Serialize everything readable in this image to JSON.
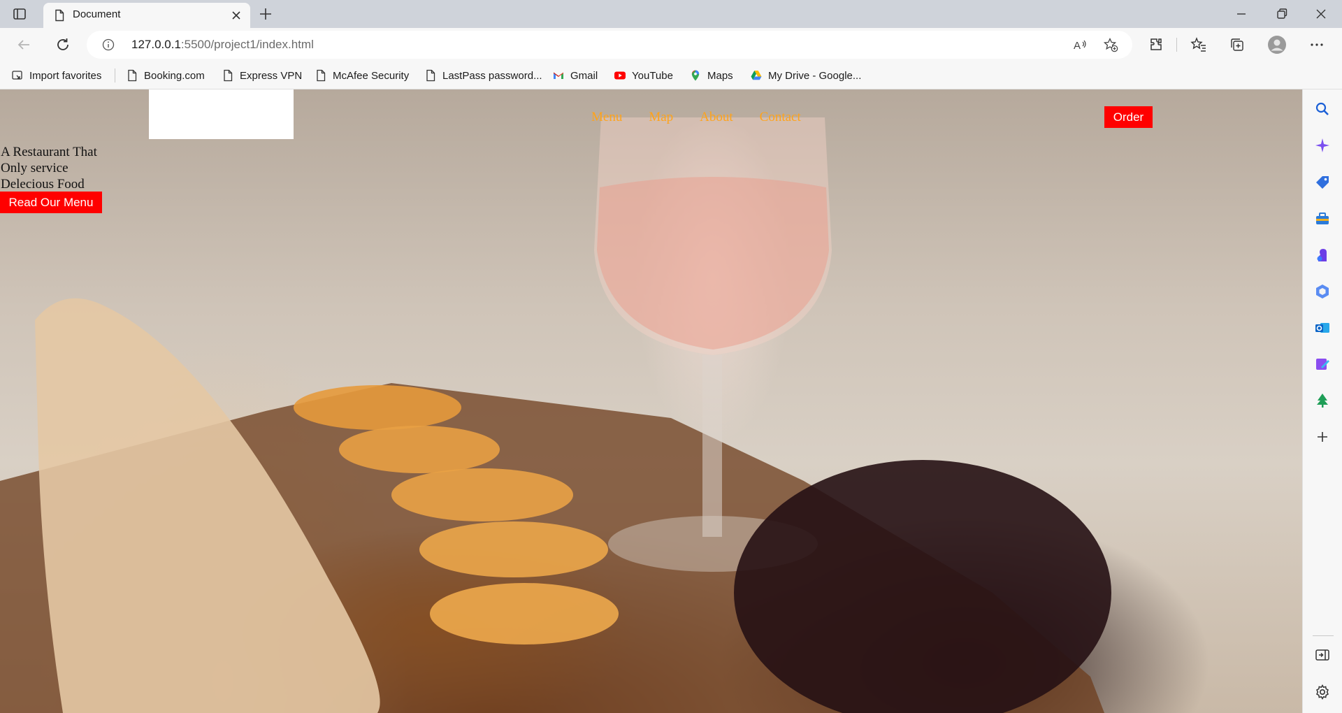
{
  "browser": {
    "tab_title": "Document",
    "url_host": "127.0.0.1",
    "url_path": ":5500/project1/index.html",
    "favorites": [
      {
        "label": "Import favorites",
        "icon": "import-icon"
      },
      {
        "label": "Booking.com",
        "icon": "page-icon"
      },
      {
        "label": "Express VPN",
        "icon": "page-icon"
      },
      {
        "label": "McAfee Security",
        "icon": "page-icon"
      },
      {
        "label": "LastPass password...",
        "icon": "page-icon"
      },
      {
        "label": "Gmail",
        "icon": "gmail-icon"
      },
      {
        "label": "YouTube",
        "icon": "youtube-icon"
      },
      {
        "label": "Maps",
        "icon": "maps-icon"
      },
      {
        "label": "My Drive - Google...",
        "icon": "drive-icon"
      }
    ]
  },
  "site": {
    "nav": [
      "Menu",
      "Map",
      "About",
      "Contact"
    ],
    "order_label": "Order",
    "hero_lines": [
      "A Restaurant That",
      "Only service",
      "Delecious Food"
    ],
    "menu_button_label": "Read Our Menu"
  },
  "colors": {
    "nav_link": "#ffa31a",
    "button_bg": "#ff0000",
    "button_text": "#ffffff"
  }
}
